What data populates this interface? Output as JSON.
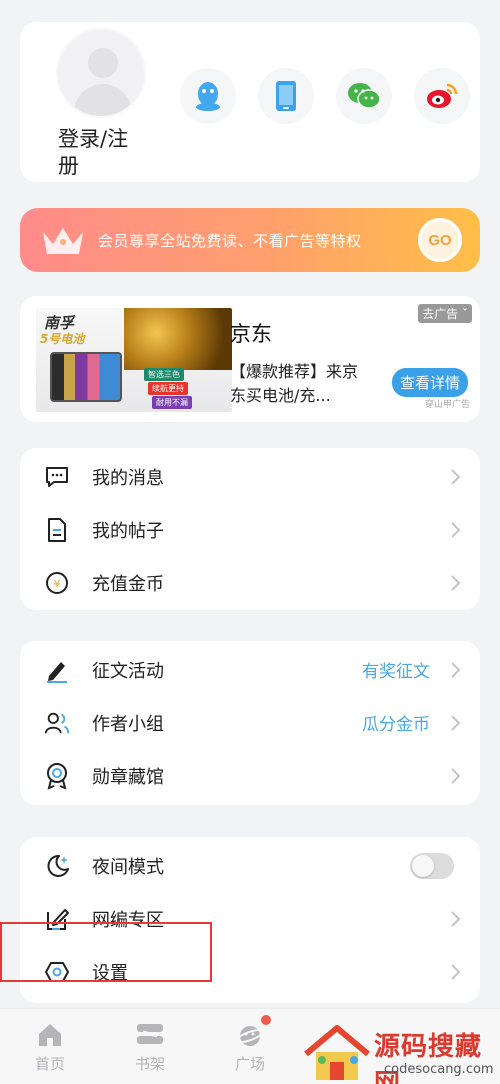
{
  "profile": {
    "login_label": "登录/注册",
    "social": [
      {
        "icon": "qq-icon",
        "color": "#42a8f0"
      },
      {
        "icon": "phone-icon",
        "color": "#3aa3f0"
      },
      {
        "icon": "wechat-icon",
        "color": "#44b549"
      },
      {
        "icon": "weibo-icon",
        "color": "#e6162d"
      }
    ]
  },
  "vip": {
    "text": "会员尊享全站免费读、不看广告等特权",
    "go_label": "GO"
  },
  "ad": {
    "title": "京东",
    "desc": "【爆款推荐】来京东买电池/充...",
    "close_label": "去广告",
    "button_label": "查看详情",
    "source": "穿山甲广告",
    "image": {
      "brand": "南孚",
      "sub": "5号电池",
      "tags": [
        "智选三色",
        "续航更持",
        "耐用不漏"
      ]
    }
  },
  "menu1": [
    {
      "label": "我的消息",
      "icon": "message-icon"
    },
    {
      "label": "我的帖子",
      "icon": "document-icon"
    },
    {
      "label": "充值金币",
      "icon": "coin-icon"
    }
  ],
  "menu2": [
    {
      "label": "征文活动",
      "icon": "pen-icon",
      "extra": "有奖征文"
    },
    {
      "label": "作者小组",
      "icon": "group-icon",
      "extra": "瓜分金币"
    },
    {
      "label": "勋章藏馆",
      "icon": "medal-icon"
    }
  ],
  "menu3": [
    {
      "label": "夜间模式",
      "icon": "moon-icon",
      "toggle": false
    },
    {
      "label": "网编专区",
      "icon": "edit-icon"
    },
    {
      "label": "设置",
      "icon": "settings-icon"
    }
  ],
  "tabs": [
    {
      "label": "首页",
      "icon": "home-icon"
    },
    {
      "label": "书架",
      "icon": "bookshelf-icon"
    },
    {
      "label": "广场",
      "icon": "planet-icon"
    }
  ],
  "watermark": {
    "text": "源码搜藏网",
    "url": "codesocang.com"
  },
  "colors": {
    "accent_blue": "#4aa8e3",
    "vip_gradient_start": "#ff8b8b",
    "vip_gradient_end": "#ffbf47",
    "highlight_red": "#e63a3a"
  }
}
